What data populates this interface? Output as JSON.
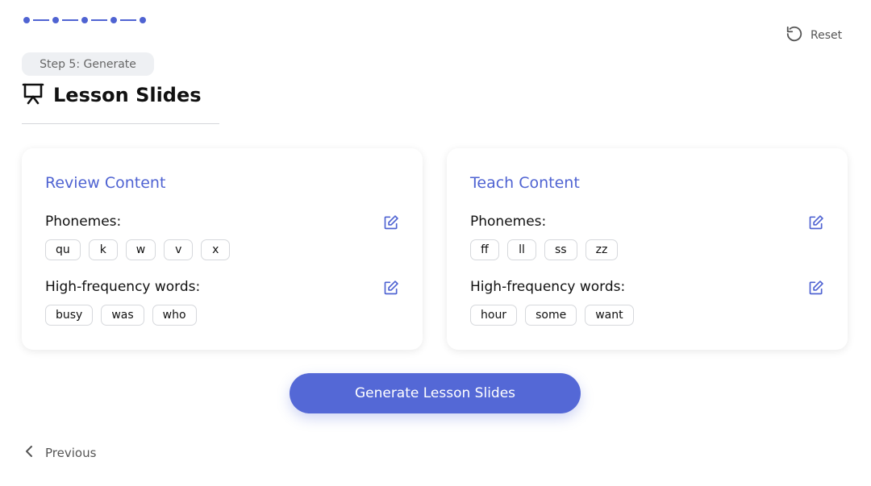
{
  "progress": {
    "total_steps": 5,
    "current_step": 5
  },
  "header": {
    "reset_label": "Reset",
    "reset_icon": "reset-icon",
    "step_label": "Step 5: Generate",
    "title": "Lesson Slides",
    "title_icon": "presentation-icon"
  },
  "review": {
    "title": "Review Content",
    "phonemes_label": "Phonemes:",
    "phonemes": [
      "qu",
      "k",
      "w",
      "v",
      "x"
    ],
    "hfw_label": "High-frequency words:",
    "hfw": [
      "busy",
      "was",
      "who"
    ]
  },
  "teach": {
    "title": "Teach Content",
    "phonemes_label": "Phonemes:",
    "phonemes": [
      "ff",
      "ll",
      "ss",
      "zz"
    ],
    "hfw_label": "High-frequency words:",
    "hfw": [
      "hour",
      "some",
      "want"
    ]
  },
  "actions": {
    "generate_label": "Generate Lesson Slides",
    "previous_label": "Previous"
  },
  "colors": {
    "accent": "#4f63d2",
    "button": "#5468d6"
  }
}
